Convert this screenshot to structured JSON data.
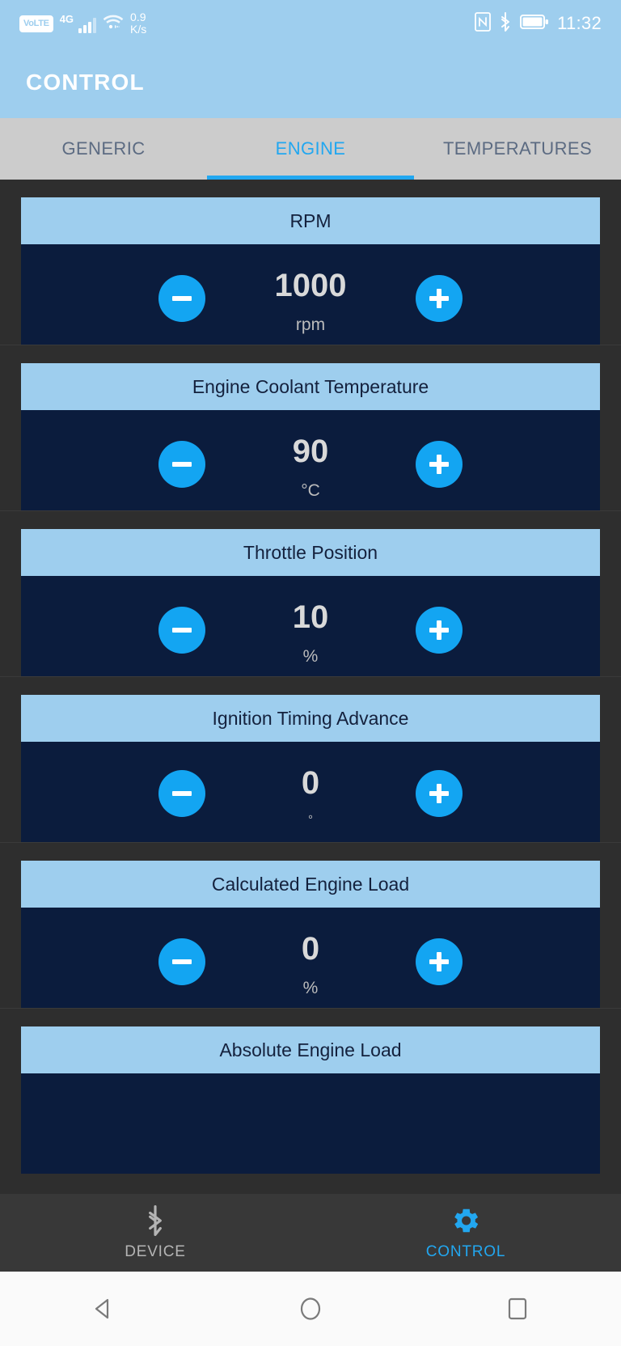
{
  "status_bar": {
    "volte_label": "VoLTE",
    "network_type": "4G",
    "network_speed": "0.9",
    "network_speed_unit": "K/s",
    "nfc_icon": "nfc-icon",
    "bluetooth_icon": "bluetooth-icon",
    "battery_icon": "battery-icon",
    "time": "11:32"
  },
  "app_bar": {
    "title": "CONTROL"
  },
  "tabs": [
    {
      "label": "GENERIC",
      "active": false
    },
    {
      "label": "ENGINE",
      "active": true
    },
    {
      "label": "TEMPERATURES",
      "active": false
    }
  ],
  "cards": [
    {
      "title": "RPM",
      "value": "1000",
      "unit": "rpm",
      "decrement": "−",
      "increment": "+"
    },
    {
      "title": "Engine Coolant Temperature",
      "value": "90",
      "unit": "°C",
      "decrement": "−",
      "increment": "+"
    },
    {
      "title": "Throttle Position",
      "value": "10",
      "unit": "%",
      "decrement": "−",
      "increment": "+"
    },
    {
      "title": "Ignition Timing Advance",
      "value": "0",
      "unit": "°",
      "decrement": "−",
      "increment": "+"
    },
    {
      "title": "Calculated Engine Load",
      "value": "0",
      "unit": "%",
      "decrement": "−",
      "increment": "+"
    },
    {
      "title": "Absolute Engine Load",
      "value": "",
      "unit": "",
      "decrement": "−",
      "increment": "+"
    }
  ],
  "bottom_nav": [
    {
      "label": "DEVICE",
      "icon": "bluetooth-icon",
      "active": false
    },
    {
      "label": "CONTROL",
      "icon": "gear-icon",
      "active": true
    }
  ],
  "system_nav": [
    {
      "name": "back-button",
      "icon": "triangle-left-icon"
    },
    {
      "name": "home-button",
      "icon": "circle-icon"
    },
    {
      "name": "recents-button",
      "icon": "square-icon"
    }
  ],
  "colors": {
    "accent_blue": "#13A5F2",
    "header_light_blue": "#9ECEEE",
    "card_body_navy": "#0b1c3d",
    "page_background": "#2e2e2e",
    "tabbar_gray": "#cccccc",
    "tab_active": "#22A7F0"
  }
}
